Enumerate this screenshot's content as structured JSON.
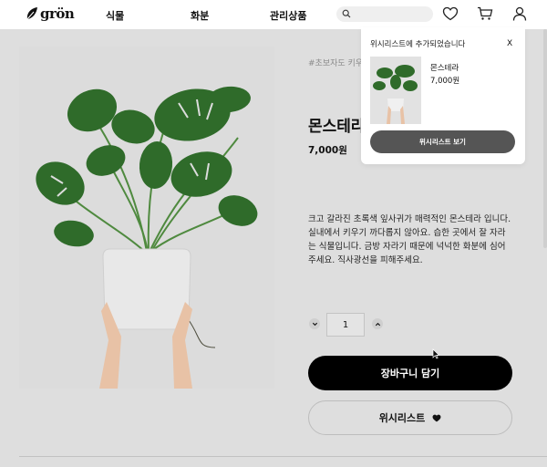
{
  "header": {
    "logo_text": "grön",
    "nav": [
      "식물",
      "화분",
      "관리상품"
    ],
    "search": {
      "placeholder": ""
    },
    "icons": [
      "search-icon",
      "heart-icon",
      "cart-icon",
      "user-icon"
    ]
  },
  "product": {
    "tag": "#초보자도 키우기 쉬워요",
    "name": "몬스테라",
    "price": "7,000원",
    "description": "크고 갈라진 초록색 잎사귀가 매력적인 몬스테라 입니다. 실내에서 키우기 까다롭지 않아요. 습한 곳에서 잘 자라는 식물입니다. 금방 자라기 때문에 넉넉한 화분에 심어주세요. 직사광선을 피해주세요.",
    "quantity": "1",
    "add_to_cart_label": "장바구니 담기",
    "wishlist_label": "위시리스트"
  },
  "toast": {
    "title": "위시리스트에 추가되었습니다",
    "close_label": "X",
    "item_name": "몬스테라",
    "item_price": "7,000원",
    "view_button_label": "위시리스트 보기"
  },
  "colors": {
    "page_bg": "#dedede",
    "header_bg": "#ffffff",
    "primary_button": "#000000",
    "toast_button": "#555555",
    "leaf": "#2f6b2a"
  }
}
